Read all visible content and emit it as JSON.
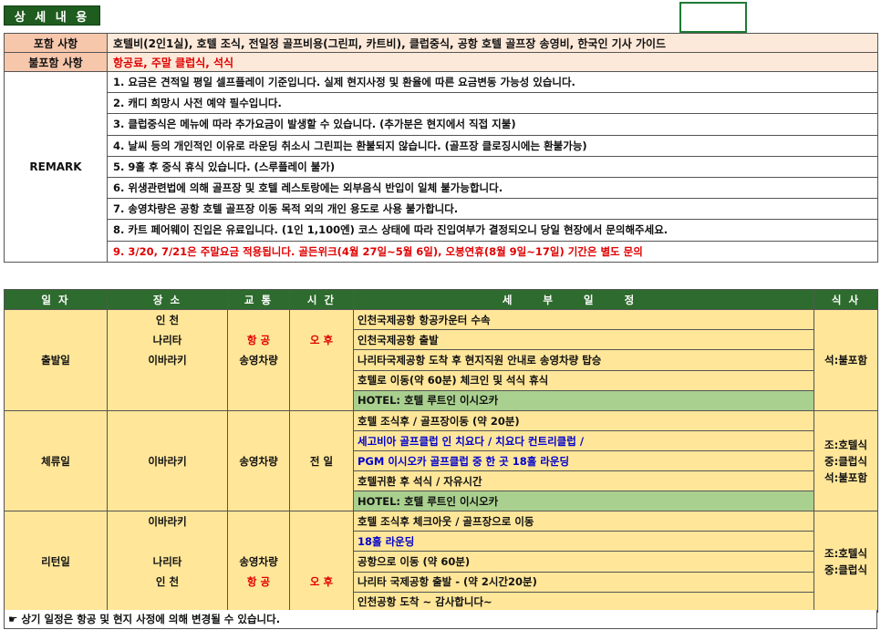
{
  "section_title": "상 세 내 용",
  "overview": {
    "include_label": "포함   사항",
    "include_value": "호텔비(2인1실), 호텔 조식, 전일정 골프비용(그린피, 카트비), 클럽중식, 공항 호텔 골프장 송영비, 한국인 기사 가이드",
    "exclude_label": "불포함  사항",
    "exclude_value": "항공료, 주말 클럽식, 석식",
    "remark_label": "REMARK",
    "remarks": [
      "1. 요금은 견적일 평일 셀프플레이 기준입니다. 실제 현지사정 및 환율에 따른 요금변동 가능성 있습니다.",
      "2. 캐디 희망시 사전 예약 필수입니다.",
      "3. 클럽중식은 메뉴에 따라 추가요금이 발생할 수 있습니다. (추가분은 현지에서 직접 지불)",
      "4. 날씨 등의 개인적인 이유로 라운딩 취소시 그린피는 환불되지 않습니다. (골프장 클로징시에는 환불가능)",
      "5. 9홀 후 중식 휴식 있습니다. (스루플레이 불가)",
      "6. 위생관련법에 의해 골프장 및 호텔 레스토랑에는 외부음식 반입이 일체 불가능합니다.",
      "7. 송영차량은 공항 호텔 골프장 이동 목적 외의 개인 용도로 사용 불가합니다.",
      "8. 카트 페어웨이 진입은 유료입니다. (1인 1,100엔) 코스 상태에 따라 진입여부가 결정되오니 당일 현장에서 문의해주세요.",
      "9. 3/20, 7/21은 주말요금 적용됩니다.  골든위크(4월 27일~5월 6일), 오봉연휴(8월 9일~17일) 기간은 별도 문의"
    ]
  },
  "schedule": {
    "headers": {
      "day": "일 자",
      "place": "장 소",
      "transport": "교 통",
      "time": "시 간",
      "detail": "세부일정",
      "meal": "식 사"
    },
    "days": [
      {
        "day": "출발일",
        "places": [
          "인  천",
          "나리타",
          "이바라키",
          "",
          ""
        ],
        "transports": [
          "",
          "항 공",
          "송영차량",
          "",
          ""
        ],
        "times": [
          "",
          "오 후",
          "",
          "",
          ""
        ],
        "details": [
          "인천국제공항 항공카운터 수속",
          "인천국제공항 출발",
          "나리타국제공항 도착 후 현지직원 안내로 송영차량 탑승",
          "호텔로 이동(약 60분) 체크인 및 석식 휴식",
          "HOTEL: 호텔 루트인 이시오카"
        ],
        "meals": [
          "석:불포함"
        ]
      },
      {
        "day": "체류일",
        "place": "이바라키",
        "transport": "송영차량",
        "time": "전 일",
        "details": [
          "호텔 조식후 / 골프장이동 (약 20분)",
          "세고비아 골프클럽 인 치요다 / 치요다 컨트리클럽 /",
          "PGM 이시오카 골프클럽 중 한 곳 18홀 라운딩",
          "호텔귀환 후 석식 / 자유시간",
          "HOTEL: 호텔 루트인 이시오카"
        ],
        "meals": [
          "조:호텔식",
          "중:클럽식",
          "석:불포함"
        ]
      },
      {
        "day": "리턴일",
        "places": [
          "이바라키",
          "",
          "나리타",
          "인  천",
          ""
        ],
        "transports": [
          "",
          "",
          "송영차량",
          "항 공",
          ""
        ],
        "times": [
          "",
          "",
          "",
          "오 후",
          ""
        ],
        "details": [
          "호텔 조식후 체크아웃 / 골프장으로 이동",
          "18홀 라운딩",
          "공항으로 이동 (약 60분)",
          "나리타 국제공항 출발 - (약 2시간20분)",
          "인천공항 도착   ~ 감사합니다~"
        ],
        "meals": [
          "조:호텔식",
          "중:클럽식"
        ]
      }
    ]
  },
  "footer_icon": "pointing-hand-icon",
  "footer_note": "상기 일정은 항공 및 현지 사정에 의해 변경될 수 있습니다.",
  "colors": {
    "header_green": "#2e6b2e",
    "label_peach": "#f7c7ac",
    "row_yellow": "#ffe699",
    "hotel_green": "#a9d08e",
    "accent_red": "#e00000",
    "accent_blue": "#0000cc"
  }
}
